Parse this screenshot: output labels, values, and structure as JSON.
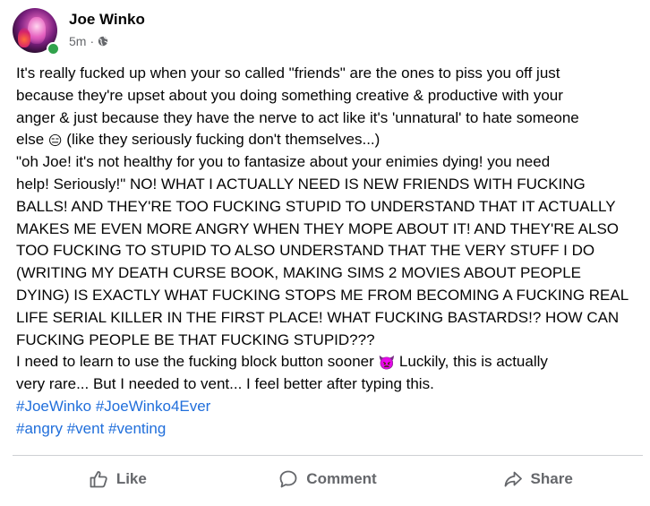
{
  "post": {
    "author": "Joe Winko",
    "timestamp": "5m",
    "separator": "·",
    "privacy_icon": "globe-icon",
    "online_status": "online",
    "text_lines": [
      "It's really fucked up when your so called \"friends\" are the ones to piss you off just",
      "because they're upset about you doing something creative & productive with your",
      "anger & just because they have the nerve to act like it's 'unnatural' to hate someone",
      "(like they seriously fucking don't themselves...)",
      "\"oh Joe! it's not healthy for you to fantasize about your enimies dying! you need",
      "help! Seriously!\" NO! WHAT I ACTUALLY NEED IS NEW FRIENDS WITH FUCKING",
      "BALLS! AND THEY'RE TOO FUCKING STUPID TO UNDERSTAND THAT IT ACTUALLY",
      "MAKES ME EVEN MORE ANGRY WHEN THEY MOPE ABOUT IT! AND THEY'RE ALSO",
      "TOO FUCKING TO STUPID TO ALSO UNDERSTAND THAT THE VERY STUFF I DO",
      "(WRITING MY DEATH CURSE BOOK, MAKING SIMS 2 MOVIES ABOUT PEOPLE",
      "DYING) IS EXACTLY WHAT FUCKING STOPS ME FROM BECOMING A FUCKING REAL",
      "LIFE SERIAL KILLER IN THE FIRST PLACE! WHAT FUCKING BASTARDS!? HOW CAN",
      "FUCKING PEOPLE BE THAT FUCKING STUPID???",
      "I need to learn to use the fucking block button sooner",
      "Luckily, this is actually",
      "very rare... But I needed to vent... I feel better after typing this."
    ],
    "line4_prefix": "else",
    "emoji_expressionless": "😑",
    "emoji_angry_devil": "👿",
    "hashtags_row1": [
      "#JoeWinko",
      "#JoeWinko4Ever"
    ],
    "hashtags_row2": [
      "#angry",
      "#vent",
      "#venting"
    ]
  },
  "actions": {
    "like": "Like",
    "comment": "Comment",
    "share": "Share"
  },
  "colors": {
    "text": "#050505",
    "secondary_text": "#65676b",
    "hashtag": "#216fdb",
    "online": "#31a24c",
    "divider": "#ced0d4"
  }
}
